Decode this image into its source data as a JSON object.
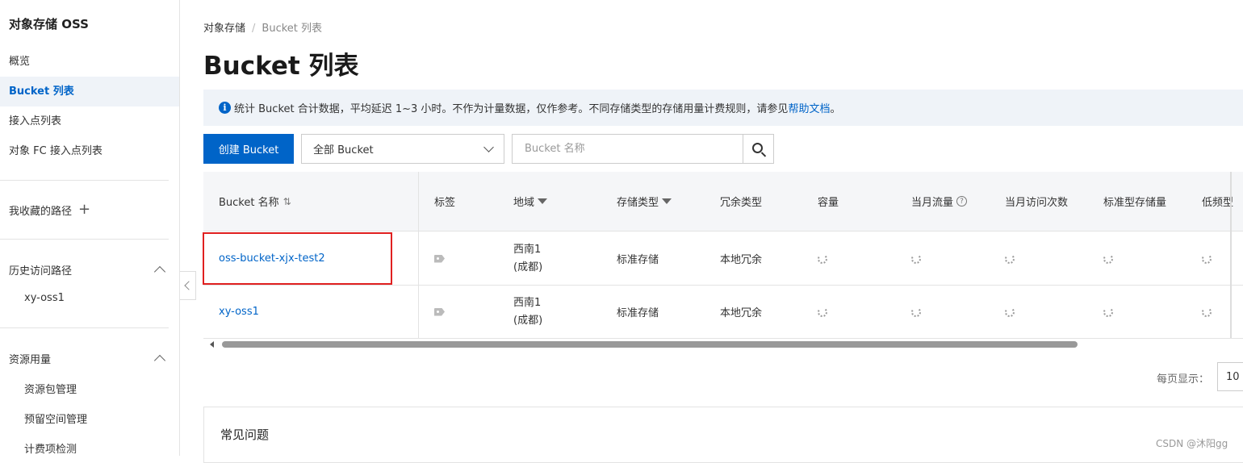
{
  "sidebar": {
    "title": "对象存储 OSS",
    "items": [
      {
        "label": "概览"
      },
      {
        "label": "Bucket 列表"
      },
      {
        "label": "接入点列表"
      },
      {
        "label": "对象 FC 接入点列表"
      }
    ],
    "favorites_label": "我收藏的路径",
    "history_label": "历史访问路径",
    "history_items": [
      "xy-oss1"
    ],
    "resource_label": "资源用量",
    "resource_items": [
      "资源包管理",
      "预留空间管理",
      "计费项检测"
    ]
  },
  "breadcrumb": {
    "root": "对象存储",
    "current": "Bucket 列表"
  },
  "page_title": "Bucket 列表",
  "notice": {
    "text": "统计 Bucket 合计数据，平均延迟 1~3 小时。不作为计量数据，仅作参考。不同存储类型的存储用量计费规则，请参见",
    "link": "帮助文档",
    "suffix": "。"
  },
  "toolbar": {
    "create_label": "创建 Bucket",
    "filter_value": "全部 Bucket",
    "search_placeholder": "Bucket 名称"
  },
  "table": {
    "headers": {
      "name": "Bucket 名称",
      "tags": "标签",
      "region": "地域",
      "storage_class": "存储类型",
      "redundancy": "冗余类型",
      "capacity": "容量",
      "traffic": "当月流量",
      "requests": "当月访问次数",
      "standard_storage": "标准型存储量",
      "ia": "低频型"
    },
    "rows": [
      {
        "name": "oss-bucket-xjx-test2",
        "region_line1": "西南1",
        "region_line2": "(成都)",
        "storage_class": "标准存储",
        "redundancy": "本地冗余"
      },
      {
        "name": "xy-oss1",
        "region_line1": "西南1",
        "region_line2": "(成都)",
        "storage_class": "标准存储",
        "redundancy": "本地冗余"
      }
    ]
  },
  "pager": {
    "label": "每页显示：",
    "value": "10"
  },
  "faq": {
    "title": "常见问题"
  },
  "watermark": "CSDN @沐阳gg",
  "colors": {
    "accent": "#0064c8",
    "highlight": "#e02020"
  }
}
